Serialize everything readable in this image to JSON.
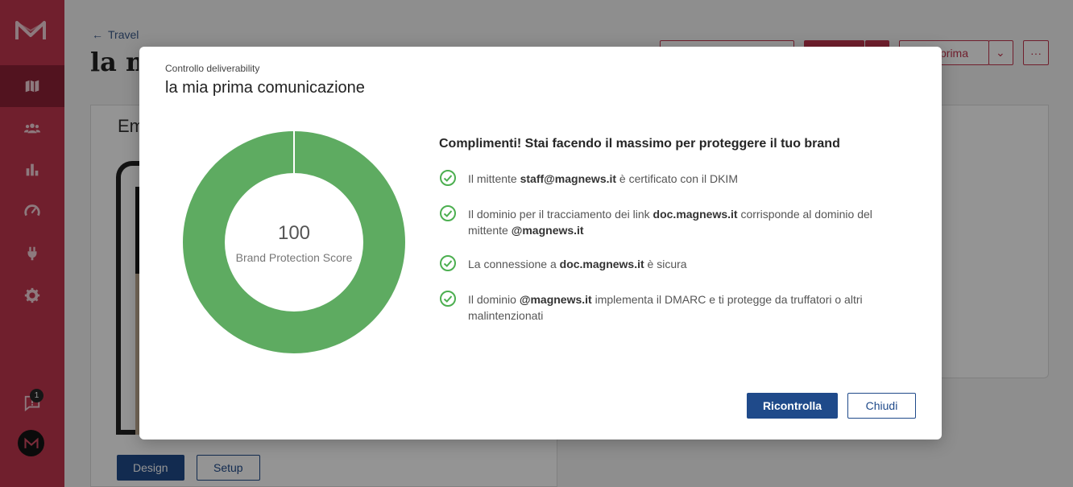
{
  "background": {
    "back_link": "Travel",
    "page_title": "la mia prima comunicazione",
    "card_title": "Email",
    "header_button_label": "prima",
    "tabs": [
      "Design",
      "Setup"
    ],
    "notification_count": "1"
  },
  "modal": {
    "subtitle": "Controllo deliverability",
    "title": "la mia prima comunicazione",
    "score": "100",
    "score_label": "Brand Protection Score",
    "score_value": 100,
    "heading": "Complimenti! Stai facendo il massimo per proteggere il tuo brand",
    "checks": [
      {
        "pre": "Il mittente ",
        "b1": "staff@magnews.it",
        "mid": " è certificato con il DKIM",
        "b2": "",
        "post": ""
      },
      {
        "pre": "Il dominio per il tracciamento dei link ",
        "b1": "doc.magnews.it",
        "mid": " corrisponde al dominio del mittente ",
        "b2": "@magnews.it",
        "post": ""
      },
      {
        "pre": "La connessione a ",
        "b1": "doc.magnews.it",
        "mid": " è sicura",
        "b2": "",
        "post": ""
      },
      {
        "pre": "Il dominio ",
        "b1": "@magnews.it",
        "mid": " implementa il DMARC e ti protegge da truffatori o altri malintenzionati",
        "b2": "",
        "post": ""
      }
    ],
    "primary_button": "Ricontrolla",
    "secondary_button": "Chiudi"
  },
  "colors": {
    "sidebar": "#c2364f",
    "donut_fill": "#5eab61",
    "check_icon": "#4caf50",
    "primary": "#1f4a8a"
  },
  "icons": {
    "sidebar": [
      "magnews-logo-icon",
      "map-icon",
      "users-icon",
      "bar-chart-icon",
      "gauge-icon",
      "plug-icon",
      "gear-icon",
      "chat-icon"
    ],
    "back": "arrow-left-icon",
    "check": "check-circle-icon"
  }
}
